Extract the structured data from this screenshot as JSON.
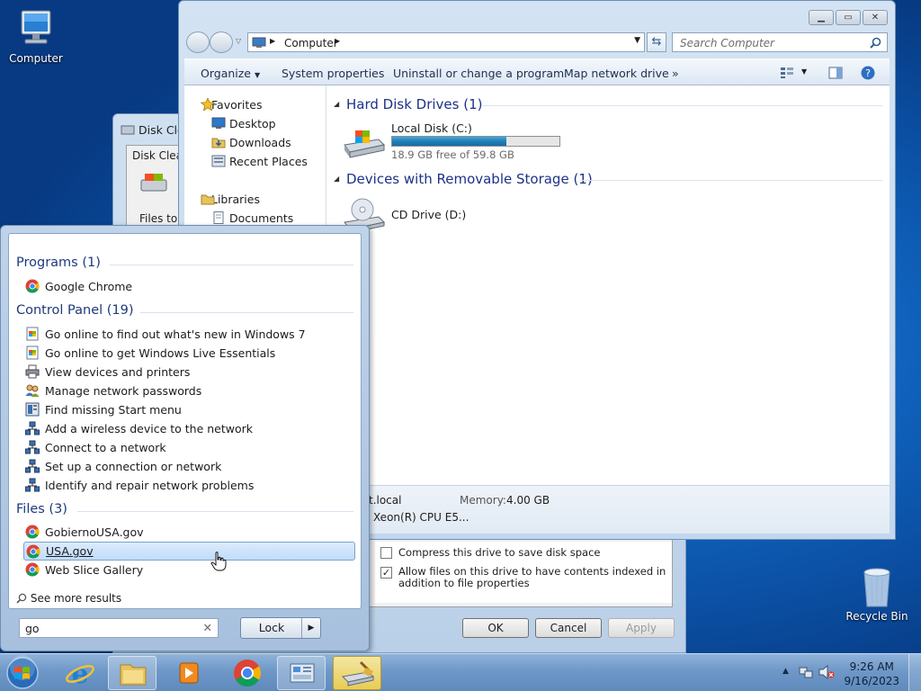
{
  "desktop": {
    "icons": [
      {
        "label": "Computer",
        "icon": "computer-icon"
      },
      {
        "label": "Recycle Bin",
        "icon": "recycle-bin-icon"
      }
    ]
  },
  "explorer": {
    "address_path": "Computer",
    "search_placeholder": "Search Computer",
    "toolbar": {
      "organize": "Organize",
      "system_properties": "System properties",
      "uninstall": "Uninstall or change a program",
      "map_drive": "Map network drive",
      "more": "»"
    },
    "nav": {
      "favorites": "Favorites",
      "desktop": "Desktop",
      "downloads": "Downloads",
      "recent_places": "Recent Places",
      "libraries": "Libraries",
      "documents": "Documents"
    },
    "groups": {
      "hard_disk": "Hard Disk Drives (1)",
      "removable": "Devices with Removable Storage (1)"
    },
    "local_disk": {
      "name": "Local Disk (C:)",
      "free_text": "18.9 GB free of 59.8 GB",
      "used_fraction": 0.684
    },
    "cd_drive": {
      "name": "CD Drive (D:)"
    },
    "details": {
      "domain_partial": "net.local",
      "memory_label": "Memory:",
      "memory_value": "4.00 GB",
      "cpu_partial": "Xeon(R) CPU E5..."
    }
  },
  "disk_cleanup": {
    "title_partial": "Disk Cle",
    "tab_partial": "Disk Clean",
    "files_partial": "Files to d",
    "compress_label": "Compress this drive to save disk space",
    "compress_checked": false,
    "index_label": "Allow files on this drive to have contents indexed in addition to file properties",
    "index_checked": true,
    "ok": "OK",
    "cancel": "Cancel",
    "apply": "Apply"
  },
  "start_menu": {
    "programs_header": "Programs (1)",
    "programs": [
      {
        "label": "Google Chrome",
        "icon": "chrome-icon"
      }
    ],
    "control_panel_header": "Control Panel (19)",
    "control_panel": [
      {
        "label": "Go online to find out what's new in Windows 7",
        "icon": "windows-doc-icon"
      },
      {
        "label": "Go online to get Windows Live Essentials",
        "icon": "windows-doc-icon"
      },
      {
        "label": "View devices and printers",
        "icon": "printer-icon"
      },
      {
        "label": "Manage network passwords",
        "icon": "users-icon"
      },
      {
        "label": "Find missing Start menu",
        "icon": "start-menu-icon"
      },
      {
        "label": "Add a wireless device to the network",
        "icon": "network-icon"
      },
      {
        "label": "Connect to a network",
        "icon": "network-icon"
      },
      {
        "label": "Set up a connection or network",
        "icon": "network-icon"
      },
      {
        "label": "Identify and repair network problems",
        "icon": "network-icon"
      }
    ],
    "files_header": "Files (3)",
    "files": [
      {
        "label": "GobiernoUSA.gov",
        "icon": "chrome-icon"
      },
      {
        "label": "USA.gov",
        "icon": "chrome-icon",
        "selected": true
      },
      {
        "label": "Web Slice Gallery",
        "icon": "chrome-icon"
      }
    ],
    "see_more": "See more results",
    "search_value": "go",
    "lock_label": "Lock",
    "lock_arrow": "▶"
  },
  "taskbar": {
    "items": [
      "start-orb",
      "internet-explorer",
      "file-explorer",
      "media-player",
      "google-chrome",
      "control-panel",
      "disk-cleanup"
    ],
    "time": "9:26 AM",
    "date": "9/16/2023"
  }
}
